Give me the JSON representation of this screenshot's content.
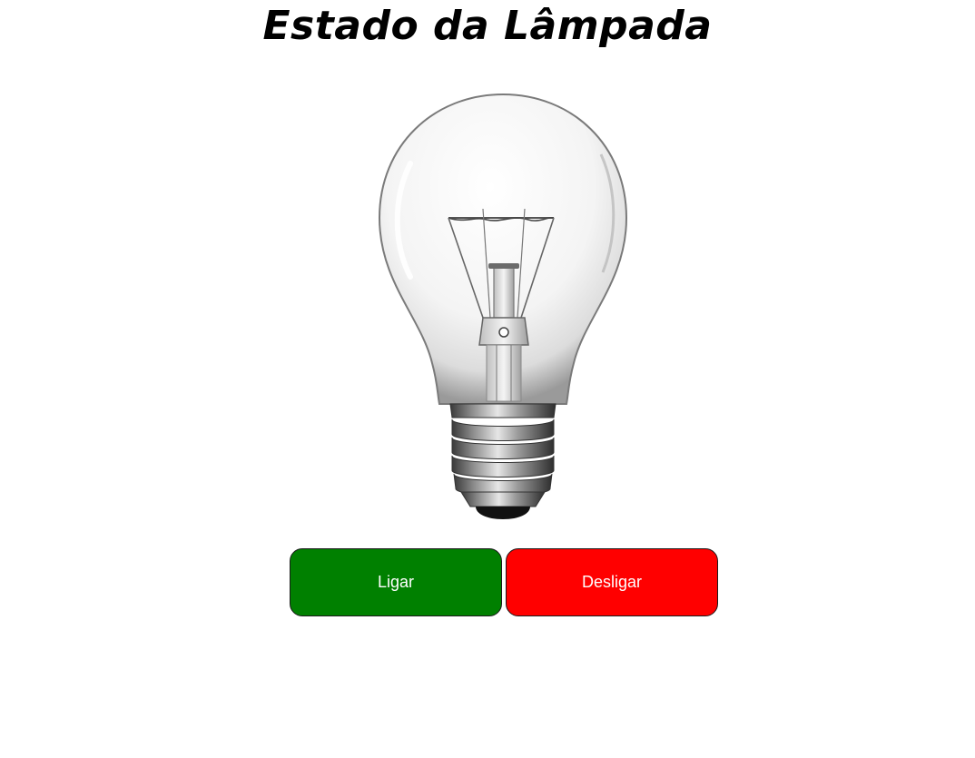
{
  "page": {
    "title": "Estado da Lâmpada"
  },
  "lamp": {
    "state": "off",
    "icon": "light-bulb-icon"
  },
  "controls": {
    "on_label": "Ligar",
    "off_label": "Desligar",
    "on_color": "#008000",
    "off_color": "#ff0000"
  }
}
